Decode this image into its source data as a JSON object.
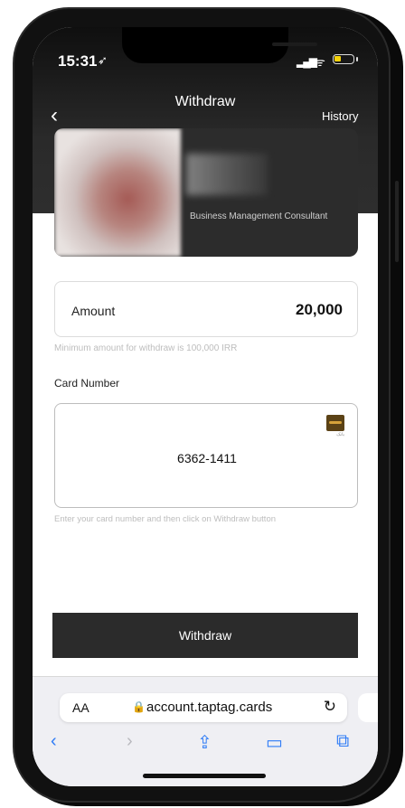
{
  "status_bar": {
    "time": "15:31",
    "location_glyph": "➶",
    "signal_glyph": "▂▄▆",
    "wifi_glyph": "ᯤ"
  },
  "header": {
    "back_glyph": "‹",
    "title": "Withdraw",
    "history_label": "History"
  },
  "profile_card": {
    "role": "Business Management Consultant"
  },
  "amount": {
    "label": "Amount",
    "value": "20,000",
    "hint": "Minimum amount for withdraw is 100,000 IRR"
  },
  "card_number": {
    "label": "Card Number",
    "value": "6362-1411",
    "hint": "Enter your card number and then click on Withdraw button",
    "bank_logo_text": "بانک"
  },
  "withdraw_button": {
    "label": "Withdraw"
  },
  "safari": {
    "aa_label": "AA",
    "lock_glyph": "🔒",
    "url": "account.taptag.cards",
    "reload_glyph": "↻",
    "toolbar": {
      "back": "‹",
      "forward": "›",
      "share": "⇪",
      "bookmarks": "▭",
      "tabs": "⧉"
    }
  },
  "colors": {
    "header_bg": "#2a2a2a",
    "button_bg": "#2b2b2b",
    "safari_blue": "#2f7cf6",
    "battery": "#f5d20b"
  }
}
